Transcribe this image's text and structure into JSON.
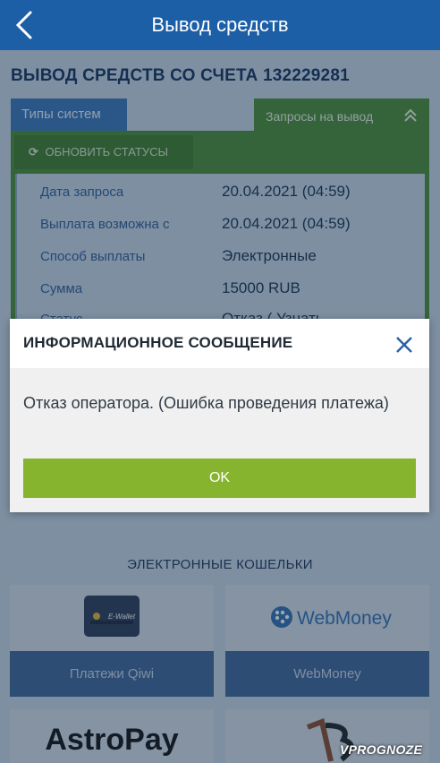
{
  "header": {
    "title": "Вывод средств"
  },
  "page": {
    "title": "ВЫВОД СРЕДСТВ СО СЧЕТА 132229281"
  },
  "tabs": {
    "types": "Типы систем",
    "requests": "Запросы на вывод"
  },
  "refresh": {
    "label": "ОБНОВИТЬ СТАТУСЫ"
  },
  "request": {
    "rows": [
      {
        "label": "Дата запроса",
        "value": "20.04.2021 (04:59)"
      },
      {
        "label": "Выплата возможна с",
        "value": "20.04.2021 (04:59)"
      },
      {
        "label": "Способ выплаты",
        "value": "Электронные"
      },
      {
        "label": "Сумма",
        "value": "15000 RUB"
      },
      {
        "label": "Статус",
        "value": "Отказ ( Узнать"
      }
    ]
  },
  "modal": {
    "title": "ИНФОРМАЦИОННОЕ СООБЩЕНИЕ",
    "message": "Отказ оператора. (Ошибка проведения платежа)",
    "ok": "OK"
  },
  "wallets": {
    "section_title": "ЭЛЕКТРОННЫЕ КОШЕЛЬКИ",
    "items": [
      {
        "logo": "E-Wallet",
        "caption": "Платежи Qiwi",
        "icon": "e-wallet-icon"
      },
      {
        "logo": "WebMoney",
        "caption": "WebMoney",
        "icon": "webmoney-globe-icon"
      },
      {
        "logo": "AstroPay",
        "caption": "",
        "icon": "astropay-logo"
      },
      {
        "logo": "",
        "caption": "",
        "icon": "bitcoin-like-logo"
      }
    ]
  },
  "watermark": "VPROGNOZE",
  "colors": {
    "header": "#1d5fa7",
    "tab_active": "#4d8c33",
    "ok_button": "#87b42f",
    "close_x": "#2a62a3"
  }
}
